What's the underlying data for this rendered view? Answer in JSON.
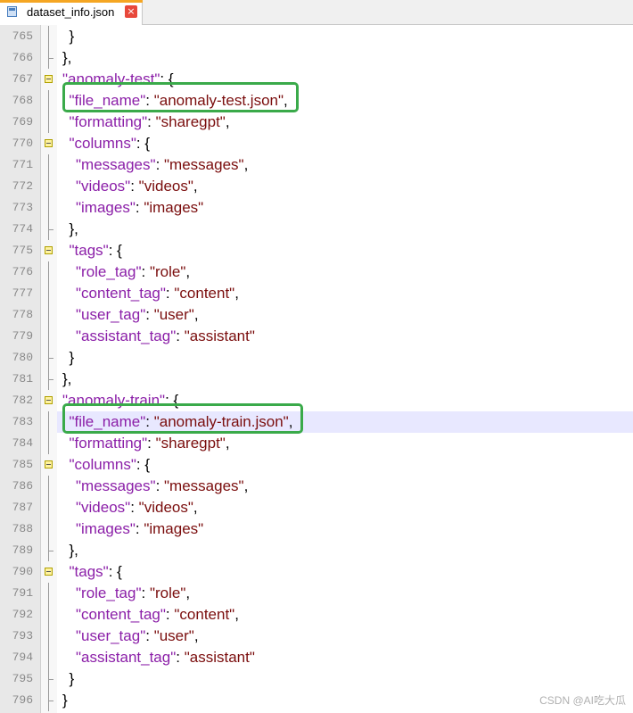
{
  "tab": {
    "filename": "dataset_info.json",
    "close": "×"
  },
  "watermark": "CSDN @AI吃大瓜",
  "lines": [
    {
      "n": "765",
      "ind": 1,
      "fold": "mid",
      "p": [
        [
          "pun",
          "}"
        ]
      ]
    },
    {
      "n": "766",
      "ind": 0,
      "fold": "end",
      "p": [
        [
          "pun",
          "},"
        ]
      ]
    },
    {
      "n": "767",
      "ind": 0,
      "fold": "start",
      "p": [
        [
          "key",
          "\"anomaly-test\""
        ],
        [
          "pun",
          ": {"
        ]
      ]
    },
    {
      "n": "768",
      "ind": 1,
      "fold": "mid",
      "p": [
        [
          "key",
          "\"file_name\""
        ],
        [
          "pun",
          ": "
        ],
        [
          "str",
          "\"anomaly-test.json\""
        ],
        [
          "pun",
          ","
        ]
      ]
    },
    {
      "n": "769",
      "ind": 1,
      "fold": "mid",
      "p": [
        [
          "key",
          "\"formatting\""
        ],
        [
          "pun",
          ": "
        ],
        [
          "str",
          "\"sharegpt\""
        ],
        [
          "pun",
          ","
        ]
      ]
    },
    {
      "n": "770",
      "ind": 1,
      "fold": "start",
      "p": [
        [
          "key",
          "\"columns\""
        ],
        [
          "pun",
          ": {"
        ]
      ]
    },
    {
      "n": "771",
      "ind": 2,
      "fold": "mid",
      "p": [
        [
          "key",
          "\"messages\""
        ],
        [
          "pun",
          ": "
        ],
        [
          "str",
          "\"messages\""
        ],
        [
          "pun",
          ","
        ]
      ]
    },
    {
      "n": "772",
      "ind": 2,
      "fold": "mid",
      "p": [
        [
          "key",
          "\"videos\""
        ],
        [
          "pun",
          ": "
        ],
        [
          "str",
          "\"videos\""
        ],
        [
          "pun",
          ","
        ]
      ]
    },
    {
      "n": "773",
      "ind": 2,
      "fold": "mid",
      "p": [
        [
          "key",
          "\"images\""
        ],
        [
          "pun",
          ": "
        ],
        [
          "str",
          "\"images\""
        ]
      ]
    },
    {
      "n": "774",
      "ind": 1,
      "fold": "end",
      "p": [
        [
          "pun",
          "},"
        ]
      ]
    },
    {
      "n": "775",
      "ind": 1,
      "fold": "start",
      "p": [
        [
          "key",
          "\"tags\""
        ],
        [
          "pun",
          ": {"
        ]
      ]
    },
    {
      "n": "776",
      "ind": 2,
      "fold": "mid",
      "p": [
        [
          "key",
          "\"role_tag\""
        ],
        [
          "pun",
          ": "
        ],
        [
          "str",
          "\"role\""
        ],
        [
          "pun",
          ","
        ]
      ]
    },
    {
      "n": "777",
      "ind": 2,
      "fold": "mid",
      "p": [
        [
          "key",
          "\"content_tag\""
        ],
        [
          "pun",
          ": "
        ],
        [
          "str",
          "\"content\""
        ],
        [
          "pun",
          ","
        ]
      ]
    },
    {
      "n": "778",
      "ind": 2,
      "fold": "mid",
      "p": [
        [
          "key",
          "\"user_tag\""
        ],
        [
          "pun",
          ": "
        ],
        [
          "str",
          "\"user\""
        ],
        [
          "pun",
          ","
        ]
      ]
    },
    {
      "n": "779",
      "ind": 2,
      "fold": "mid",
      "p": [
        [
          "key",
          "\"assistant_tag\""
        ],
        [
          "pun",
          ": "
        ],
        [
          "str",
          "\"assistant\""
        ]
      ]
    },
    {
      "n": "780",
      "ind": 1,
      "fold": "end",
      "p": [
        [
          "pun",
          "}"
        ]
      ]
    },
    {
      "n": "781",
      "ind": 0,
      "fold": "end",
      "p": [
        [
          "pun",
          "},"
        ]
      ]
    },
    {
      "n": "782",
      "ind": 0,
      "fold": "start",
      "p": [
        [
          "key",
          "\"anomaly-train\""
        ],
        [
          "pun",
          ": {"
        ]
      ]
    },
    {
      "n": "783",
      "ind": 1,
      "fold": "mid",
      "current": true,
      "p": [
        [
          "key",
          "\"file_name\""
        ],
        [
          "pun",
          ": "
        ],
        [
          "str",
          "\"anomaly-train.json\""
        ],
        [
          "pun",
          ","
        ]
      ]
    },
    {
      "n": "784",
      "ind": 1,
      "fold": "mid",
      "p": [
        [
          "key",
          "\"formatting\""
        ],
        [
          "pun",
          ": "
        ],
        [
          "str",
          "\"sharegpt\""
        ],
        [
          "pun",
          ","
        ]
      ]
    },
    {
      "n": "785",
      "ind": 1,
      "fold": "start",
      "p": [
        [
          "key",
          "\"columns\""
        ],
        [
          "pun",
          ": {"
        ]
      ]
    },
    {
      "n": "786",
      "ind": 2,
      "fold": "mid",
      "p": [
        [
          "key",
          "\"messages\""
        ],
        [
          "pun",
          ": "
        ],
        [
          "str",
          "\"messages\""
        ],
        [
          "pun",
          ","
        ]
      ]
    },
    {
      "n": "787",
      "ind": 2,
      "fold": "mid",
      "p": [
        [
          "key",
          "\"videos\""
        ],
        [
          "pun",
          ": "
        ],
        [
          "str",
          "\"videos\""
        ],
        [
          "pun",
          ","
        ]
      ]
    },
    {
      "n": "788",
      "ind": 2,
      "fold": "mid",
      "p": [
        [
          "key",
          "\"images\""
        ],
        [
          "pun",
          ": "
        ],
        [
          "str",
          "\"images\""
        ]
      ]
    },
    {
      "n": "789",
      "ind": 1,
      "fold": "end",
      "p": [
        [
          "pun",
          "},"
        ]
      ]
    },
    {
      "n": "790",
      "ind": 1,
      "fold": "start",
      "p": [
        [
          "key",
          "\"tags\""
        ],
        [
          "pun",
          ": {"
        ]
      ]
    },
    {
      "n": "791",
      "ind": 2,
      "fold": "mid",
      "p": [
        [
          "key",
          "\"role_tag\""
        ],
        [
          "pun",
          ": "
        ],
        [
          "str",
          "\"role\""
        ],
        [
          "pun",
          ","
        ]
      ]
    },
    {
      "n": "792",
      "ind": 2,
      "fold": "mid",
      "p": [
        [
          "key",
          "\"content_tag\""
        ],
        [
          "pun",
          ": "
        ],
        [
          "str",
          "\"content\""
        ],
        [
          "pun",
          ","
        ]
      ]
    },
    {
      "n": "793",
      "ind": 2,
      "fold": "mid",
      "p": [
        [
          "key",
          "\"user_tag\""
        ],
        [
          "pun",
          ": "
        ],
        [
          "str",
          "\"user\""
        ],
        [
          "pun",
          ","
        ]
      ]
    },
    {
      "n": "794",
      "ind": 2,
      "fold": "mid",
      "p": [
        [
          "key",
          "\"assistant_tag\""
        ],
        [
          "pun",
          ": "
        ],
        [
          "str",
          "\"assistant\""
        ]
      ]
    },
    {
      "n": "795",
      "ind": 1,
      "fold": "end",
      "p": [
        [
          "pun",
          "}"
        ]
      ]
    },
    {
      "n": "796",
      "ind": 0,
      "fold": "end",
      "p": [
        [
          "pun",
          "}"
        ]
      ]
    }
  ],
  "highlights": [
    "768",
    "783"
  ],
  "colors": {
    "key": "#8b1fa8",
    "string": "#7a0d0d",
    "highlight_box": "#3aaa4a",
    "current_line": "#e8e8ff"
  }
}
